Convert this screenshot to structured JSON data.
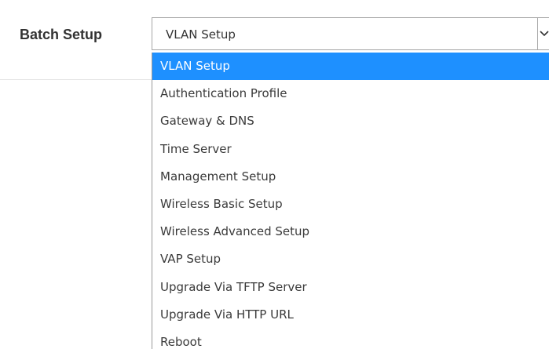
{
  "form": {
    "label": "Batch Setup"
  },
  "select": {
    "current_value": "VLAN Setup",
    "arrow_icon": "chevron-down-icon",
    "options": [
      {
        "label": "VLAN Setup",
        "selected": true
      },
      {
        "label": "Authentication Profile",
        "selected": false
      },
      {
        "label": "Gateway & DNS",
        "selected": false
      },
      {
        "label": "Time Server",
        "selected": false
      },
      {
        "label": "Management Setup",
        "selected": false
      },
      {
        "label": "Wireless Basic Setup",
        "selected": false
      },
      {
        "label": "Wireless Advanced Setup",
        "selected": false
      },
      {
        "label": "VAP Setup",
        "selected": false
      },
      {
        "label": "Upgrade Via TFTP Server",
        "selected": false
      },
      {
        "label": "Upgrade Via HTTP URL",
        "selected": false
      },
      {
        "label": "Reboot",
        "selected": false
      }
    ]
  },
  "colors": {
    "highlight": "#1e90ff",
    "text": "#3a3a3a",
    "border": "#a6a6a6"
  }
}
